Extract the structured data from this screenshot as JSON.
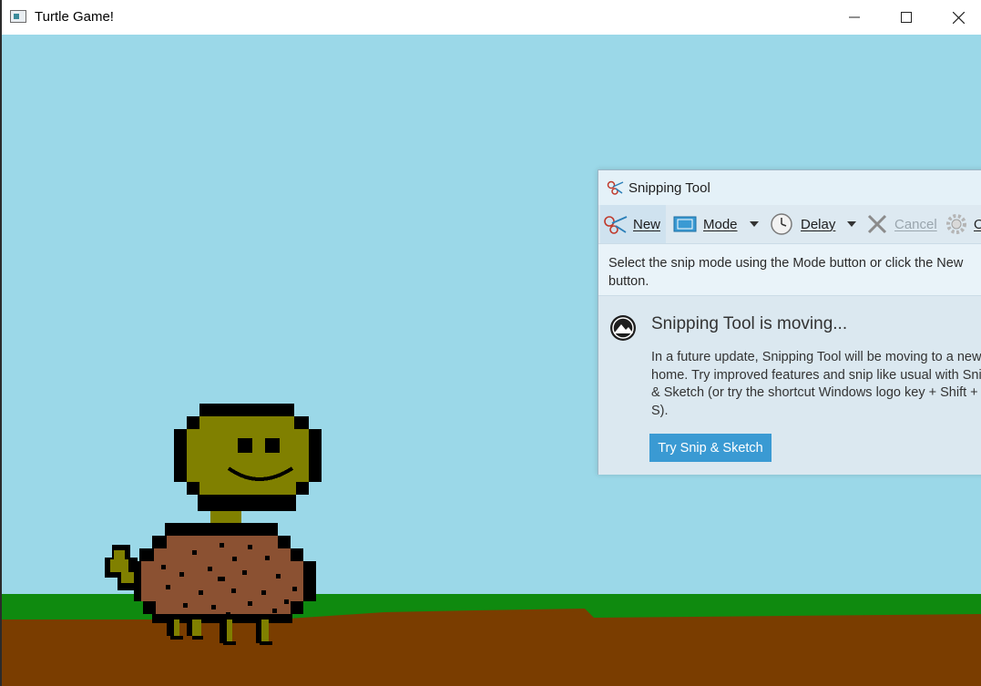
{
  "window": {
    "title": "Turtle Game!",
    "buttons": {
      "minimize": "—",
      "maximize": "☐",
      "close": "✕"
    }
  },
  "colors": {
    "sky": "#9bd8e8",
    "grass": "#0f8a0f",
    "dirt": "#7a3d00",
    "turtle_skin": "#808000",
    "turtle_shell": "#8b5132",
    "accent_button": "#3a9ad3"
  },
  "snipping_tool": {
    "title": "Snipping Tool",
    "toolbar": {
      "new": "New",
      "mode": "Mode",
      "delay": "Delay",
      "cancel": "Cancel",
      "options_partial": "O"
    },
    "instruction": "Select the snip mode using the Mode button or click the New button.",
    "moving": {
      "heading": "Snipping Tool is moving...",
      "body": "In a future update, Snipping Tool will be moving to a new home. Try improved features and snip like usual with Snip & Sketch (or try the shortcut Windows logo key + Shift + S).",
      "button": "Try Snip & Sketch"
    }
  }
}
